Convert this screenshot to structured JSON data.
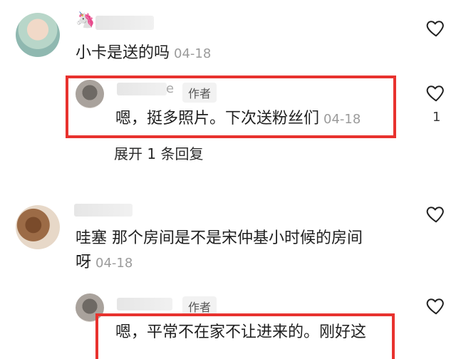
{
  "comments": [
    {
      "text": "小卡是送的吗",
      "date": "04-18",
      "reply": {
        "tag": "作者",
        "username_tail": "e",
        "text": "嗯，挺多照片。下次送粉丝们",
        "date": "04-18",
        "likes": "1"
      },
      "expand_label": "展开 1 条回复"
    },
    {
      "text_line1": "哇塞 那个房间是不是宋仲基小时候的房间",
      "text_line2": "呀",
      "date": "04-18",
      "reply": {
        "tag": "作者",
        "text": "嗯，平常不在家不让进来的。刚好这"
      }
    }
  ],
  "icons": {
    "like": "heart-outline-icon",
    "unicorn": "unicorn-icon"
  },
  "colors": {
    "highlight_border": "#e8322e",
    "secondary_text": "#9b9b9b"
  }
}
